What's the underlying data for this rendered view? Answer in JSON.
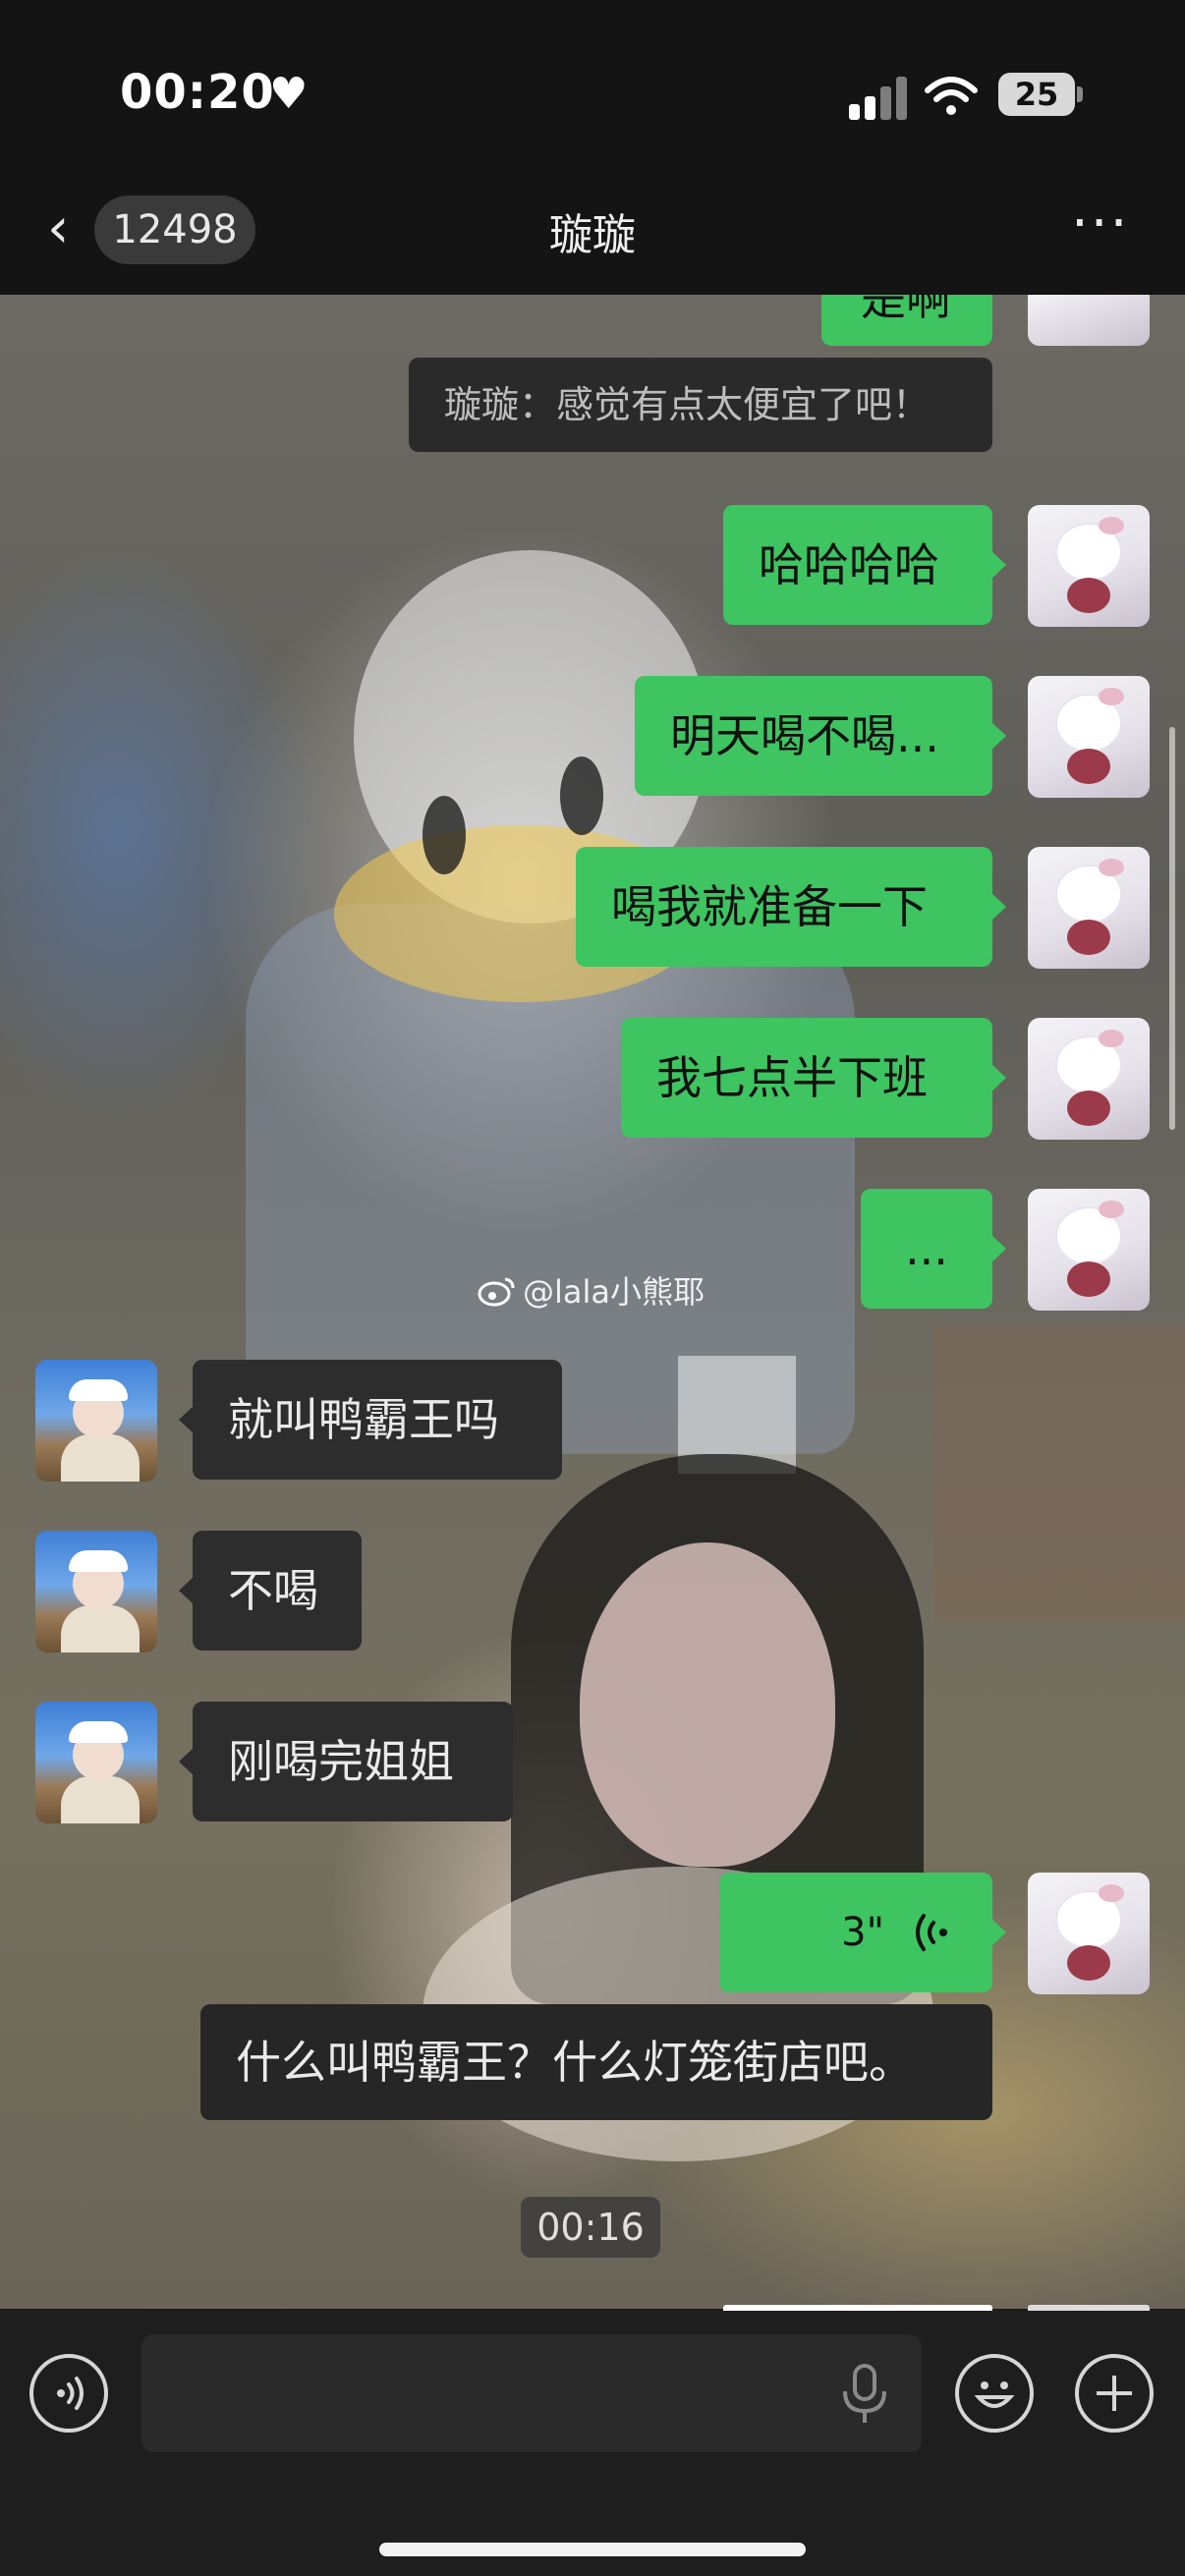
{
  "status_bar": {
    "time": "00:20",
    "battery": "25"
  },
  "nav": {
    "unread_count": "12498",
    "title": "璇璇"
  },
  "quote": {
    "text": "璇璇：感觉有点太便宜了吧！"
  },
  "messages": {
    "m1": {
      "text": "哈哈哈哈"
    },
    "m2": {
      "text": "明天喝不喝..."
    },
    "m3": {
      "text": "喝我就准备一下"
    },
    "m4": {
      "text": "我七点半下班"
    },
    "m5": {
      "text": "..."
    },
    "m6": {
      "text": "就叫鸭霸王吗"
    },
    "m7": {
      "text": "不喝"
    },
    "m8": {
      "text": "刚喝完姐姐"
    },
    "voice": {
      "duration": "3\""
    }
  },
  "partial_top": {
    "text": "是啊"
  },
  "watermark": {
    "text": "@lala小熊耶"
  },
  "transcript": {
    "text": "什么叫鸭霸王？什么灯笼街店吧。"
  },
  "video_time": "00:16",
  "icons": {
    "back": "chevron-left-icon",
    "more": "more-dots-icon",
    "voice_toggle": "voice-icon",
    "mic": "microphone-icon",
    "emoji": "emoji-icon",
    "plus": "plus-icon"
  },
  "colors": {
    "sent_bubble": "#3ec461",
    "received_bubble": "#2d2d2d",
    "bar": "#141414"
  }
}
